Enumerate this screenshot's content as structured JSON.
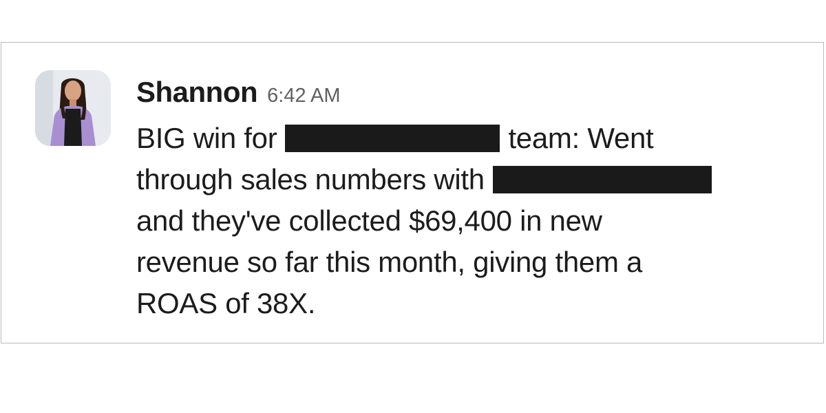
{
  "message": {
    "sender": "Shannon",
    "timestamp": "6:42 AM",
    "lines": [
      {
        "before": "BIG win for",
        "after": "team: Went"
      },
      {
        "before": "through sales numbers with",
        "after": ""
      },
      {
        "text": "and they've collected $69,400 in new"
      },
      {
        "text": "revenue so far this month, giving them a"
      },
      {
        "text": "ROAS of 38X."
      }
    ]
  },
  "avatar": {
    "icon": "profile-photo",
    "colors": {
      "background": "#e7ebef",
      "jacket": "#a88fd1",
      "top": "#1b1b1b",
      "hair": "#2b1b14",
      "skin": "#d8a383"
    }
  },
  "colors": {
    "text": "#1d1c1d",
    "timestamp": "#616061",
    "redaction": "#1a1a1a",
    "border": "#b9b9b9"
  }
}
